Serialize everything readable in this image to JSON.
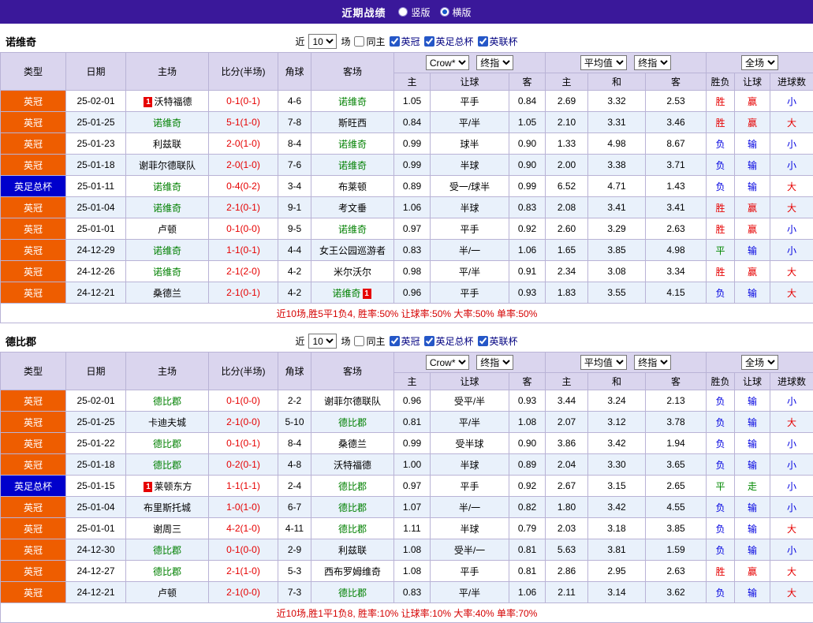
{
  "topbar": {
    "title": "近期战绩",
    "options": [
      {
        "label": "竖版",
        "selected": false
      },
      {
        "label": "横版",
        "selected": true
      }
    ]
  },
  "colors": {
    "header_purple": "#3a189a",
    "league_championship_bg": "#ee5d00",
    "league_facup_bg": "#0000cc",
    "focus_team_green": "#008000",
    "win_red": "#e60000",
    "lose_blue": "#0000e0",
    "draw_green": "#008800",
    "row_alt_blue": "#e9f1fb",
    "table_header_bg": "#dad5ee"
  },
  "table_headers": {
    "type": "类型",
    "date": "日期",
    "home": "主场",
    "score": "比分(半场)",
    "corner": "角球",
    "away": "客场",
    "odds_sub": [
      "主",
      "让球",
      "客"
    ],
    "avg_sub": [
      "主",
      "和",
      "客"
    ],
    "full_sub": [
      "胜负",
      "让球",
      "进球数"
    ]
  },
  "sections": [
    {
      "team": "诺维奇",
      "filter": {
        "near_label": "近",
        "count": "10",
        "games_label": "场",
        "same_home": {
          "label": "同主",
          "checked": false
        },
        "leagues": [
          {
            "label": "英冠",
            "checked": true
          },
          {
            "label": "英足总杯",
            "checked": true
          },
          {
            "label": "英联杯",
            "checked": true
          }
        ]
      },
      "selects": {
        "odds_source": "Crow*",
        "odds_stage": "终指",
        "avg_source": "平均值",
        "avg_stage": "终指",
        "full": "全场"
      },
      "rows": [
        {
          "type": "英冠",
          "type_color": "orange",
          "date": "25-02-01",
          "home": "沃特福德",
          "home_focus": false,
          "home_badge_pre": "1",
          "score": "0-1(0-1)",
          "corner": "4-6",
          "away": "诺维奇",
          "away_focus": true,
          "odds": [
            "1.05",
            "平手",
            "0.84"
          ],
          "avg": [
            "2.69",
            "3.32",
            "2.53"
          ],
          "result": "胜",
          "cover": "赢",
          "goals": "小"
        },
        {
          "type": "英冠",
          "type_color": "orange",
          "date": "25-01-25",
          "home": "诺维奇",
          "home_focus": true,
          "score": "5-1(1-0)",
          "corner": "7-8",
          "away": "斯旺西",
          "away_focus": false,
          "odds": [
            "0.84",
            "平/半",
            "1.05"
          ],
          "avg": [
            "2.10",
            "3.31",
            "3.46"
          ],
          "result": "胜",
          "cover": "赢",
          "goals": "大"
        },
        {
          "type": "英冠",
          "type_color": "orange",
          "date": "25-01-23",
          "home": "利兹联",
          "home_focus": false,
          "score": "2-0(1-0)",
          "corner": "8-4",
          "away": "诺维奇",
          "away_focus": true,
          "odds": [
            "0.99",
            "球半",
            "0.90"
          ],
          "avg": [
            "1.33",
            "4.98",
            "8.67"
          ],
          "result": "负",
          "cover": "输",
          "goals": "小"
        },
        {
          "type": "英冠",
          "type_color": "orange",
          "date": "25-01-18",
          "home": "谢菲尔德联队",
          "home_focus": false,
          "score": "2-0(1-0)",
          "corner": "7-6",
          "away": "诺维奇",
          "away_focus": true,
          "odds": [
            "0.99",
            "半球",
            "0.90"
          ],
          "avg": [
            "2.00",
            "3.38",
            "3.71"
          ],
          "result": "负",
          "cover": "输",
          "goals": "小"
        },
        {
          "type": "英足总杯",
          "type_color": "blue",
          "date": "25-01-11",
          "home": "诺维奇",
          "home_focus": true,
          "score": "0-4(0-2)",
          "corner": "3-4",
          "away": "布莱顿",
          "away_focus": false,
          "odds": [
            "0.89",
            "受一/球半",
            "0.99"
          ],
          "avg": [
            "6.52",
            "4.71",
            "1.43"
          ],
          "result": "负",
          "cover": "输",
          "goals": "大"
        },
        {
          "type": "英冠",
          "type_color": "orange",
          "date": "25-01-04",
          "home": "诺维奇",
          "home_focus": true,
          "score": "2-1(0-1)",
          "corner": "9-1",
          "away": "考文垂",
          "away_focus": false,
          "odds": [
            "1.06",
            "半球",
            "0.83"
          ],
          "avg": [
            "2.08",
            "3.41",
            "3.41"
          ],
          "result": "胜",
          "cover": "赢",
          "goals": "大"
        },
        {
          "type": "英冠",
          "type_color": "orange",
          "date": "25-01-01",
          "home": "卢顿",
          "home_focus": false,
          "score": "0-1(0-0)",
          "corner": "9-5",
          "away": "诺维奇",
          "away_focus": true,
          "odds": [
            "0.97",
            "平手",
            "0.92"
          ],
          "avg": [
            "2.60",
            "3.29",
            "2.63"
          ],
          "result": "胜",
          "cover": "赢",
          "goals": "小"
        },
        {
          "type": "英冠",
          "type_color": "orange",
          "date": "24-12-29",
          "home": "诺维奇",
          "home_focus": true,
          "score": "1-1(0-1)",
          "corner": "4-4",
          "away": "女王公园巡游者",
          "away_focus": false,
          "odds": [
            "0.83",
            "半/一",
            "1.06"
          ],
          "avg": [
            "1.65",
            "3.85",
            "4.98"
          ],
          "result": "平",
          "cover": "输",
          "goals": "小"
        },
        {
          "type": "英冠",
          "type_color": "orange",
          "date": "24-12-26",
          "home": "诺维奇",
          "home_focus": true,
          "score": "2-1(2-0)",
          "corner": "4-2",
          "away": "米尔沃尔",
          "away_focus": false,
          "odds": [
            "0.98",
            "平/半",
            "0.91"
          ],
          "avg": [
            "2.34",
            "3.08",
            "3.34"
          ],
          "result": "胜",
          "cover": "赢",
          "goals": "大"
        },
        {
          "type": "英冠",
          "type_color": "orange",
          "date": "24-12-21",
          "home": "桑德兰",
          "home_focus": false,
          "score": "2-1(0-1)",
          "corner": "4-2",
          "away": "诺维奇",
          "away_focus": true,
          "away_badge_post": "1",
          "odds": [
            "0.96",
            "平手",
            "0.93"
          ],
          "avg": [
            "1.83",
            "3.55",
            "4.15"
          ],
          "result": "负",
          "cover": "输",
          "goals": "大"
        }
      ],
      "summary": "近10场,胜5平1负4, 胜率:50% 让球率:50% 大率:50% 单率:50%"
    },
    {
      "team": "德比郡",
      "filter": {
        "near_label": "近",
        "count": "10",
        "games_label": "场",
        "same_home": {
          "label": "同主",
          "checked": false
        },
        "leagues": [
          {
            "label": "英冠",
            "checked": true
          },
          {
            "label": "英足总杯",
            "checked": true
          },
          {
            "label": "英联杯",
            "checked": true
          }
        ]
      },
      "selects": {
        "odds_source": "Crow*",
        "odds_stage": "终指",
        "avg_source": "平均值",
        "avg_stage": "终指",
        "full": "全场"
      },
      "rows": [
        {
          "type": "英冠",
          "type_color": "orange",
          "date": "25-02-01",
          "home": "德比郡",
          "home_focus": true,
          "score": "0-1(0-0)",
          "corner": "2-2",
          "away": "谢菲尔德联队",
          "away_focus": false,
          "odds": [
            "0.96",
            "受平/半",
            "0.93"
          ],
          "avg": [
            "3.44",
            "3.24",
            "2.13"
          ],
          "result": "负",
          "cover": "输",
          "goals": "小"
        },
        {
          "type": "英冠",
          "type_color": "orange",
          "date": "25-01-25",
          "home": "卡迪夫城",
          "home_focus": false,
          "score": "2-1(0-0)",
          "corner": "5-10",
          "away": "德比郡",
          "away_focus": true,
          "odds": [
            "0.81",
            "平/半",
            "1.08"
          ],
          "avg": [
            "2.07",
            "3.12",
            "3.78"
          ],
          "result": "负",
          "cover": "输",
          "goals": "大"
        },
        {
          "type": "英冠",
          "type_color": "orange",
          "date": "25-01-22",
          "home": "德比郡",
          "home_focus": true,
          "score": "0-1(0-1)",
          "corner": "8-4",
          "away": "桑德兰",
          "away_focus": false,
          "odds": [
            "0.99",
            "受半球",
            "0.90"
          ],
          "avg": [
            "3.86",
            "3.42",
            "1.94"
          ],
          "result": "负",
          "cover": "输",
          "goals": "小"
        },
        {
          "type": "英冠",
          "type_color": "orange",
          "date": "25-01-18",
          "home": "德比郡",
          "home_focus": true,
          "score": "0-2(0-1)",
          "corner": "4-8",
          "away": "沃特福德",
          "away_focus": false,
          "odds": [
            "1.00",
            "半球",
            "0.89"
          ],
          "avg": [
            "2.04",
            "3.30",
            "3.65"
          ],
          "result": "负",
          "cover": "输",
          "goals": "小"
        },
        {
          "type": "英足总杯",
          "type_color": "blue",
          "date": "25-01-15",
          "home": "莱顿东方",
          "home_focus": false,
          "home_badge_pre": "1",
          "score": "1-1(1-1)",
          "corner": "2-4",
          "away": "德比郡",
          "away_focus": true,
          "odds": [
            "0.97",
            "平手",
            "0.92"
          ],
          "avg": [
            "2.67",
            "3.15",
            "2.65"
          ],
          "result": "平",
          "cover": "走",
          "goals": "小"
        },
        {
          "type": "英冠",
          "type_color": "orange",
          "date": "25-01-04",
          "home": "布里斯托城",
          "home_focus": false,
          "score": "1-0(1-0)",
          "corner": "6-7",
          "away": "德比郡",
          "away_focus": true,
          "odds": [
            "1.07",
            "半/一",
            "0.82"
          ],
          "avg": [
            "1.80",
            "3.42",
            "4.55"
          ],
          "result": "负",
          "cover": "输",
          "goals": "小"
        },
        {
          "type": "英冠",
          "type_color": "orange",
          "date": "25-01-01",
          "home": "谢周三",
          "home_focus": false,
          "score": "4-2(1-0)",
          "corner": "4-11",
          "away": "德比郡",
          "away_focus": true,
          "odds": [
            "1.11",
            "半球",
            "0.79"
          ],
          "avg": [
            "2.03",
            "3.18",
            "3.85"
          ],
          "result": "负",
          "cover": "输",
          "goals": "大"
        },
        {
          "type": "英冠",
          "type_color": "orange",
          "date": "24-12-30",
          "home": "德比郡",
          "home_focus": true,
          "score": "0-1(0-0)",
          "corner": "2-9",
          "away": "利兹联",
          "away_focus": false,
          "odds": [
            "1.08",
            "受半/一",
            "0.81"
          ],
          "avg": [
            "5.63",
            "3.81",
            "1.59"
          ],
          "result": "负",
          "cover": "输",
          "goals": "小"
        },
        {
          "type": "英冠",
          "type_color": "orange",
          "date": "24-12-27",
          "home": "德比郡",
          "home_focus": true,
          "score": "2-1(1-0)",
          "corner": "5-3",
          "away": "西布罗姆维奇",
          "away_focus": false,
          "odds": [
            "1.08",
            "平手",
            "0.81"
          ],
          "avg": [
            "2.86",
            "2.95",
            "2.63"
          ],
          "result": "胜",
          "cover": "赢",
          "goals": "大"
        },
        {
          "type": "英冠",
          "type_color": "orange",
          "date": "24-12-21",
          "home": "卢顿",
          "home_focus": false,
          "score": "2-1(0-0)",
          "corner": "7-3",
          "away": "德比郡",
          "away_focus": true,
          "odds": [
            "0.83",
            "平/半",
            "1.06"
          ],
          "avg": [
            "2.11",
            "3.14",
            "3.62"
          ],
          "result": "负",
          "cover": "输",
          "goals": "大"
        }
      ],
      "summary": "近10场,胜1平1负8, 胜率:10% 让球率:10% 大率:40% 单率:70%"
    }
  ]
}
